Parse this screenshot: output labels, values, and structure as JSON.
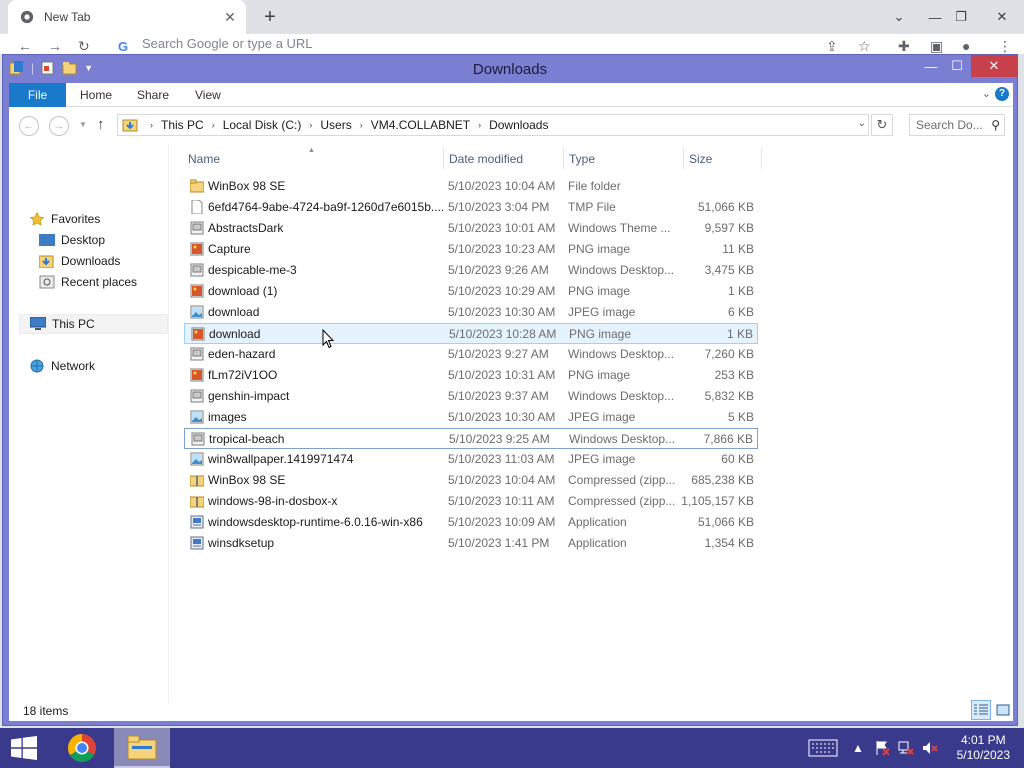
{
  "chrome": {
    "tab_title": "New Tab",
    "omnibox_placeholder": "Search Google or type a URL"
  },
  "window": {
    "title": "Downloads",
    "close_glyph": "✕",
    "maximize_glyph": "☐",
    "minimize_glyph": "—"
  },
  "ribbon": {
    "tabs": [
      "File",
      "Home",
      "Share",
      "View"
    ],
    "help": "?"
  },
  "address": {
    "crumbs": [
      "This PC",
      "Local Disk (C:)",
      "Users",
      "VM4.COLLABNET",
      "Downloads"
    ],
    "search_placeholder": "Search Do..."
  },
  "nav": {
    "favorites": "Favorites",
    "desktop": "Desktop",
    "downloads": "Downloads",
    "recent": "Recent places",
    "this_pc": "This PC",
    "network": "Network"
  },
  "columns": {
    "name": "Name",
    "date": "Date modified",
    "type": "Type",
    "size": "Size"
  },
  "files": [
    {
      "name": "WinBox 98 SE",
      "date": "5/10/2023 10:04 AM",
      "type": "File folder",
      "size": "",
      "icon": "folder-icon"
    },
    {
      "name": "6efd4764-9abe-4724-ba9f-1260d7e6015b....",
      "date": "5/10/2023 3:04 PM",
      "type": "TMP File",
      "size": "51,066 KB",
      "icon": "blank-file-icon"
    },
    {
      "name": "AbstractsDark",
      "date": "5/10/2023 10:01 AM",
      "type": "Windows Theme ...",
      "size": "9,597 KB",
      "icon": "theme-file-icon"
    },
    {
      "name": "Capture",
      "date": "5/10/2023 10:23 AM",
      "type": "PNG image",
      "size": "11 KB",
      "icon": "png-image-icon"
    },
    {
      "name": "despicable-me-3",
      "date": "5/10/2023 9:26 AM",
      "type": "Windows Desktop...",
      "size": "3,475 KB",
      "icon": "theme-file-icon"
    },
    {
      "name": "download (1)",
      "date": "5/10/2023 10:29 AM",
      "type": "PNG image",
      "size": "1 KB",
      "icon": "png-image-icon"
    },
    {
      "name": "download",
      "date": "5/10/2023 10:30 AM",
      "type": "JPEG image",
      "size": "6 KB",
      "icon": "jpeg-image-icon"
    },
    {
      "name": "download",
      "date": "5/10/2023 10:28 AM",
      "type": "PNG image",
      "size": "1 KB",
      "icon": "png-image-icon"
    },
    {
      "name": "eden-hazard",
      "date": "5/10/2023 9:27 AM",
      "type": "Windows Desktop...",
      "size": "7,260 KB",
      "icon": "theme-file-icon"
    },
    {
      "name": "fLm72iV1OO",
      "date": "5/10/2023 10:31 AM",
      "type": "PNG image",
      "size": "253 KB",
      "icon": "png-image-icon"
    },
    {
      "name": "genshin-impact",
      "date": "5/10/2023 9:37 AM",
      "type": "Windows Desktop...",
      "size": "5,832 KB",
      "icon": "theme-file-icon"
    },
    {
      "name": "images",
      "date": "5/10/2023 10:30 AM",
      "type": "JPEG image",
      "size": "5 KB",
      "icon": "jpeg-image-icon"
    },
    {
      "name": "tropical-beach",
      "date": "5/10/2023 9:25 AM",
      "type": "Windows Desktop...",
      "size": "7,866 KB",
      "icon": "theme-file-icon"
    },
    {
      "name": "win8wallpaper.1419971474",
      "date": "5/10/2023 11:03 AM",
      "type": "JPEG image",
      "size": "60 KB",
      "icon": "jpeg-image-icon"
    },
    {
      "name": "WinBox 98 SE",
      "date": "5/10/2023 10:04 AM",
      "type": "Compressed (zipp...",
      "size": "685,238 KB",
      "icon": "zip-folder-icon"
    },
    {
      "name": "windows-98-in-dosbox-x",
      "date": "5/10/2023 10:11 AM",
      "type": "Compressed (zipp...",
      "size": "1,105,157 KB",
      "icon": "zip-folder-icon"
    },
    {
      "name": "windowsdesktop-runtime-6.0.16-win-x86",
      "date": "5/10/2023 10:09 AM",
      "type": "Application",
      "size": "51,066 KB",
      "icon": "installer-icon"
    },
    {
      "name": "winsdksetup",
      "date": "5/10/2023 1:41 PM",
      "type": "Application",
      "size": "1,354 KB",
      "icon": "installer-icon"
    }
  ],
  "status": {
    "item_count": "18 items"
  },
  "taskbar": {
    "time": "4:01 PM",
    "date": "5/10/2023"
  },
  "colors": {
    "window_frame": "#7b7fd3",
    "taskbar": "#3a3a8c",
    "accent": "#1979ca",
    "hover_row": "#e5f3ff",
    "close_button": "#c7404a"
  }
}
